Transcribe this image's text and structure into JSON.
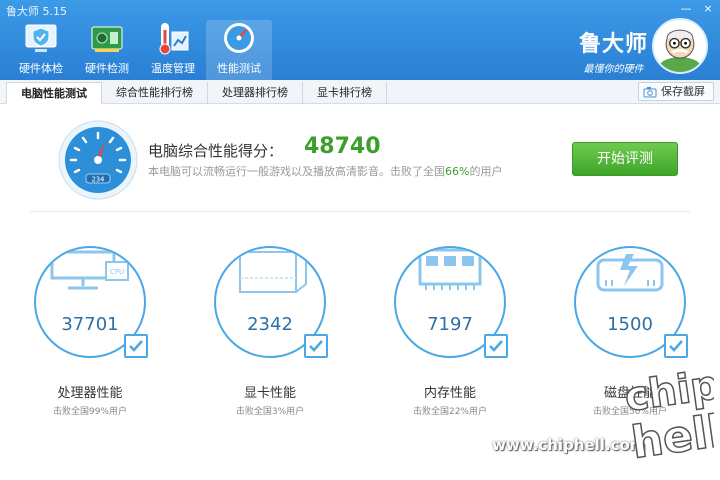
{
  "app": {
    "title": "鲁大师 5.15"
  },
  "window": {
    "minimize": "—",
    "close": "×"
  },
  "nav": [
    {
      "label": "硬件体检",
      "icon": "shield-check-icon"
    },
    {
      "label": "硬件检测",
      "icon": "circuit-board-icon"
    },
    {
      "label": "温度管理",
      "icon": "thermometer-icon"
    },
    {
      "label": "性能测试",
      "icon": "speedometer-icon"
    }
  ],
  "brand": {
    "name": "鲁大师",
    "slogan": "最懂你的硬件"
  },
  "tabs": [
    {
      "label": "电脑性能测试"
    },
    {
      "label": "综合性能排行榜"
    },
    {
      "label": "处理器排行榜"
    },
    {
      "label": "显卡排行榜"
    }
  ],
  "toolbar": {
    "save_screenshot": "保存截屏"
  },
  "score": {
    "label": "电脑综合性能得分：",
    "value": "48740",
    "desc_prefix": "本电脑可以流畅运行一般游戏以及播放高清影音。击败了全国",
    "percent": "66%",
    "desc_suffix": "的用户",
    "gauge_readout": "234"
  },
  "start_button": "开始评测",
  "components": [
    {
      "name": "处理器性能",
      "value": "37701",
      "beat": "击败全国99%用户",
      "icon": "cpu-monitor-icon"
    },
    {
      "name": "显卡性能",
      "value": "2342",
      "beat": "击败全国3%用户",
      "icon": "graphics-card-icon"
    },
    {
      "name": "内存性能",
      "value": "7197",
      "beat": "击败全国22%用户",
      "icon": "memory-module-icon"
    },
    {
      "name": "磁盘性能",
      "value": "1500",
      "beat": "击败全国50%用户",
      "icon": "hard-disk-icon"
    }
  ],
  "watermark": {
    "url": "www.chiphell.com",
    "logo_text": "chip hell"
  }
}
